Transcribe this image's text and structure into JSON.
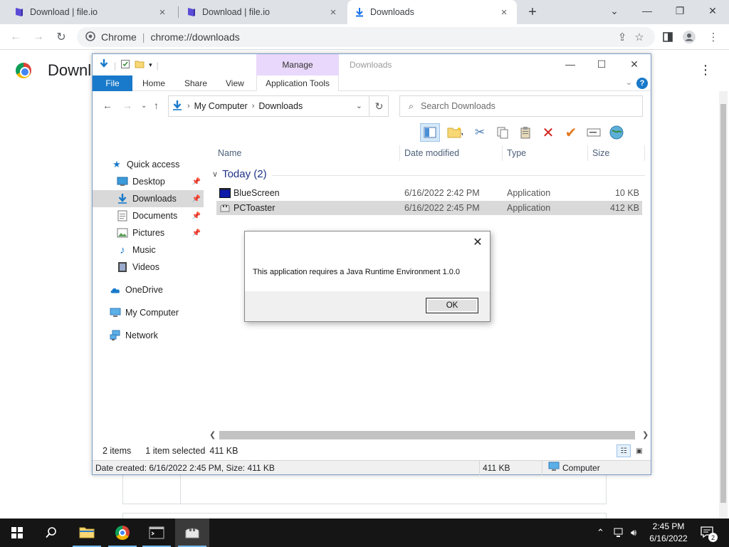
{
  "browser": {
    "tabs": [
      {
        "title": "Download | file.io"
      },
      {
        "title": "Download | file.io"
      },
      {
        "title": "Downloads"
      }
    ],
    "omnibox_site": "Chrome",
    "omnibox_url": "chrome://downloads",
    "page_title": "Downl"
  },
  "explorer": {
    "ribbon_tabs": {
      "file": "File",
      "home": "Home",
      "share": "Share",
      "view": "View",
      "manage": "Manage",
      "app_tools": "Application Tools"
    },
    "window_title": "Downloads",
    "breadcrumb": [
      "My Computer",
      "Downloads"
    ],
    "search_placeholder": "Search Downloads",
    "nav": {
      "quick_access": "Quick access",
      "desktop": "Desktop",
      "downloads": "Downloads",
      "documents": "Documents",
      "pictures": "Pictures",
      "music": "Music",
      "videos": "Videos",
      "onedrive": "OneDrive",
      "my_computer": "My Computer",
      "network": "Network"
    },
    "columns": {
      "name": "Name",
      "date": "Date modified",
      "type": "Type",
      "size": "Size"
    },
    "group": "Today (2)",
    "files": [
      {
        "name": "BlueScreen",
        "date": "6/16/2022 2:42 PM",
        "type": "Application",
        "size": "10 KB"
      },
      {
        "name": "PCToaster",
        "date": "6/16/2022 2:45 PM",
        "type": "Application",
        "size": "412 KB"
      }
    ],
    "status": {
      "items": "2 items",
      "selected": "1 item selected",
      "selected_size": "411 KB"
    },
    "infobar": {
      "details": "Date created: 6/16/2022 2:45 PM, Size: 411 KB",
      "size": "411 KB",
      "location": "Computer"
    }
  },
  "dialog": {
    "message": "This application requires a Java Runtime Environment 1.0.0",
    "ok_label": "OK"
  },
  "taskbar": {
    "time": "2:45 PM",
    "date": "6/16/2022",
    "notifications": "2"
  }
}
